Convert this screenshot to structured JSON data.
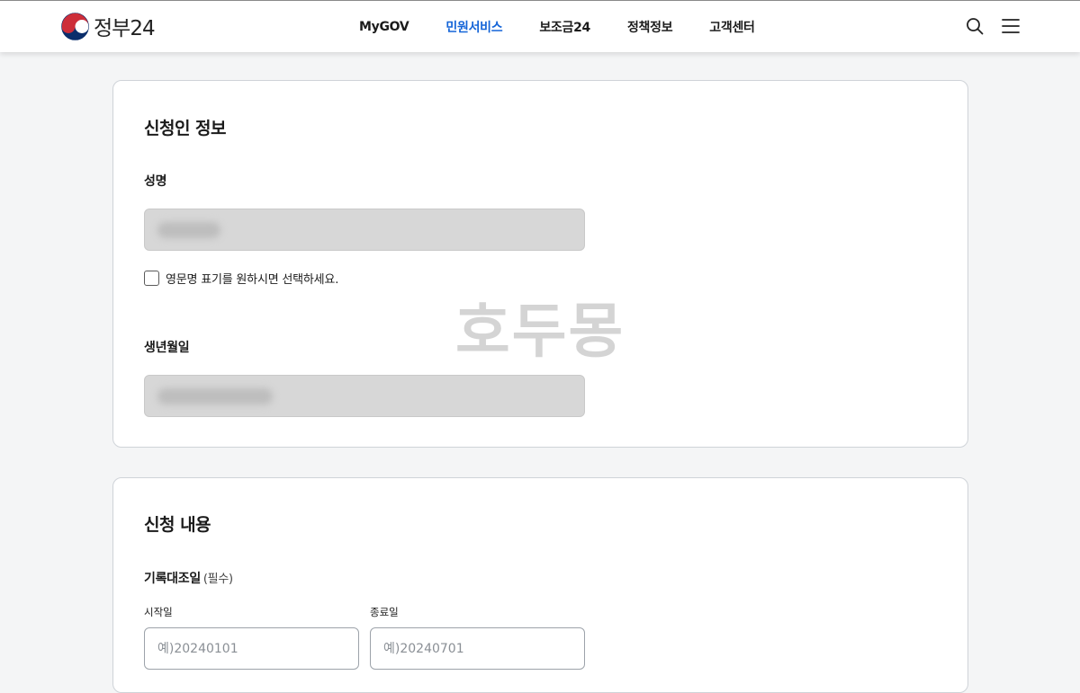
{
  "header": {
    "logo_text": "정부24",
    "nav": [
      {
        "label": "MyGOV",
        "active": false
      },
      {
        "label": "민원서비스",
        "active": true
      },
      {
        "label": "보조금24",
        "active": false
      },
      {
        "label": "정책정보",
        "active": false
      },
      {
        "label": "고객센터",
        "active": false
      }
    ],
    "search_icon": "search-icon",
    "menu_icon": "hamburger-menu-icon",
    "active_color": "#1565d8"
  },
  "applicant": {
    "title": "신청인 정보",
    "name_label": "성명",
    "english_name_checkbox": "영문명 표기를 원하시면 선택하세요.",
    "birth_label": "생년월일"
  },
  "watermark": "호두몽",
  "request": {
    "title": "신청 내용",
    "period_label": "기록대조일",
    "required_hint": "(필수)",
    "start_label": "시작일",
    "end_label": "종료일",
    "start_placeholder": "예)20240101",
    "end_placeholder": "예)20240701"
  }
}
